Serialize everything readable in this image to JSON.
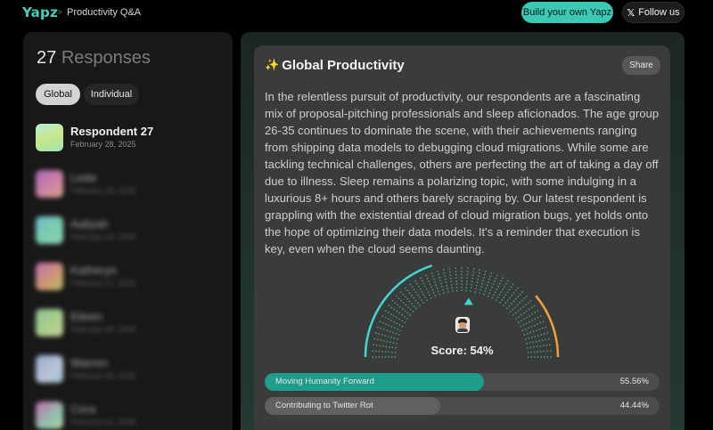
{
  "header": {
    "logo": "Yapz",
    "separator": ">",
    "breadcrumb": "Productivity Q&A",
    "build_label": "Build your own Yapz",
    "follow_label": "Follow us",
    "follow_icon": "x-logo-icon"
  },
  "sidebar": {
    "count": "27",
    "count_label": "Responses",
    "tabs": [
      {
        "label": "Global",
        "active": true
      },
      {
        "label": "Individual",
        "active": false
      }
    ],
    "responses": [
      {
        "name": "Respondent 27",
        "date": "February 28, 2025",
        "blurred": false
      },
      {
        "name": "Leda",
        "date": "February 28, 2025",
        "blurred": true
      },
      {
        "name": "Aaliyah",
        "date": "February 18, 2025",
        "blurred": true
      },
      {
        "name": "Katheryn",
        "date": "February 17, 2025",
        "blurred": true
      },
      {
        "name": "Eileen",
        "date": "February 08, 2025",
        "blurred": true
      },
      {
        "name": "Warren",
        "date": "February 05, 2025",
        "blurred": true
      },
      {
        "name": "Cora",
        "date": "February 02, 2025",
        "blurred": true
      }
    ]
  },
  "main": {
    "title": "Global Productivity",
    "title_icon": "sparkle-icon",
    "share_label": "Share",
    "summary": "In the relentless pursuit of productivity, our respondents are a fascinating mix of proposal-pitching professionals and sleep aficionados. The age group 26-35 continues to dominate the scene, with their achievements ranging from shipping data models to debugging cloud migrations. While some are tackling technical challenges, others are perfecting the art of taking a day off due to illness. Sleep remains a polarizing topic, with some indulging in a luxurious 8+ hours and others barely scraping by. Our latest respondent is grappling with the existential dread of cloud migration bugs, yet holds onto the hope of optimizing their data models. It's a reminder that execution is key, even when the cloud seems daunting.",
    "score_label": "Score: 54%",
    "score_value": 54,
    "bars": [
      {
        "label": "Moving Humanity Forward",
        "percent": 55.56,
        "percent_label": "55.56%",
        "color": "#1f9d8c"
      },
      {
        "label": "Contributing to Twitter Rot",
        "percent": 44.44,
        "percent_label": "44.44%",
        "color": "#5f6260"
      }
    ]
  },
  "colors": {
    "accent": "#3cc8b3",
    "gauge_left": "#3fd8d0",
    "gauge_right": "#f0a040",
    "gauge_dots": "#4fa59a"
  }
}
